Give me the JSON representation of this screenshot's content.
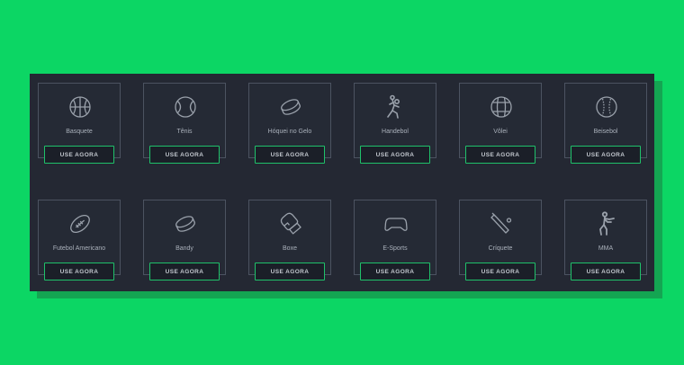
{
  "button_label": "USE AGORA",
  "colors": {
    "background": "#0cd664",
    "panel": "#242833",
    "accent": "#1fc16a"
  },
  "sports": [
    {
      "label": "Basquete",
      "icon": "basketball-icon"
    },
    {
      "label": "Tênis",
      "icon": "tennis-ball-icon"
    },
    {
      "label": "Hóquei no Gelo",
      "icon": "hockey-puck-icon"
    },
    {
      "label": "Handebol",
      "icon": "handball-player-icon"
    },
    {
      "label": "Vôlei",
      "icon": "volleyball-icon"
    },
    {
      "label": "Beisebol",
      "icon": "baseball-icon"
    },
    {
      "label": "Futebol Americano",
      "icon": "american-football-icon"
    },
    {
      "label": "Bandy",
      "icon": "bandy-puck-icon"
    },
    {
      "label": "Boxe",
      "icon": "boxing-glove-icon"
    },
    {
      "label": "E-Sports",
      "icon": "gamepad-icon"
    },
    {
      "label": "Críquete",
      "icon": "cricket-bat-icon"
    },
    {
      "label": "MMA",
      "icon": "mma-fighter-icon"
    }
  ]
}
